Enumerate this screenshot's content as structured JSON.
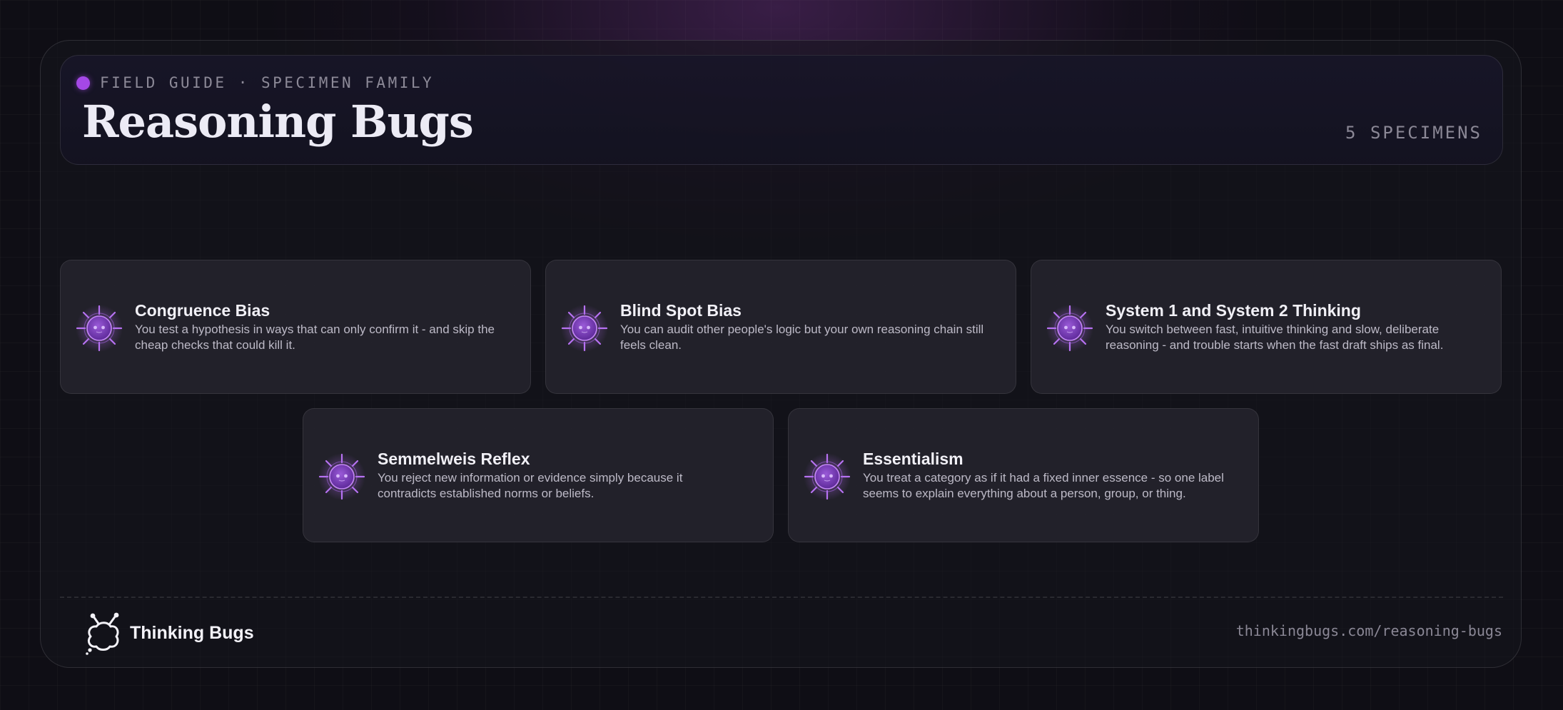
{
  "header": {
    "eyebrow": "FIELD GUIDE · SPECIMEN FAMILY",
    "title": "Reasoning Bugs",
    "count": "5 SPECIMENS"
  },
  "cards": [
    {
      "name": "Congruence Bias",
      "description": "You test a hypothesis in ways that can only confirm it - and skip the cheap checks that could kill it.",
      "icon": "bug-specimen-icon"
    },
    {
      "name": "Blind Spot Bias",
      "description": "You can audit other people's logic but your own reasoning chain still feels clean.",
      "icon": "bug-specimen-icon"
    },
    {
      "name": "System 1 and System 2 Thinking",
      "description": "You switch between fast, intuitive thinking and slow, deliberate reasoning - and trouble starts when the fast draft ships as final.",
      "icon": "bug-specimen-icon"
    },
    {
      "name": "Semmelweis Reflex",
      "description": "You reject new information or evidence simply because it contradicts established norms or beliefs.",
      "icon": "bug-specimen-icon"
    },
    {
      "name": "Essentialism",
      "description": "You treat a category as if it had a fixed inner essence - so one label seems to explain everything about a person, group, or thing.",
      "icon": "bug-specimen-icon"
    }
  ],
  "footer": {
    "brand": "Thinking Bugs",
    "logo_icon": "thinking-bugs-logo-icon",
    "url": "thinkingbugs.com/reasoning-bugs"
  },
  "colors": {
    "accent": "#a448e6",
    "bug_body": "#7b3fc0",
    "background": "#0f0e15"
  }
}
